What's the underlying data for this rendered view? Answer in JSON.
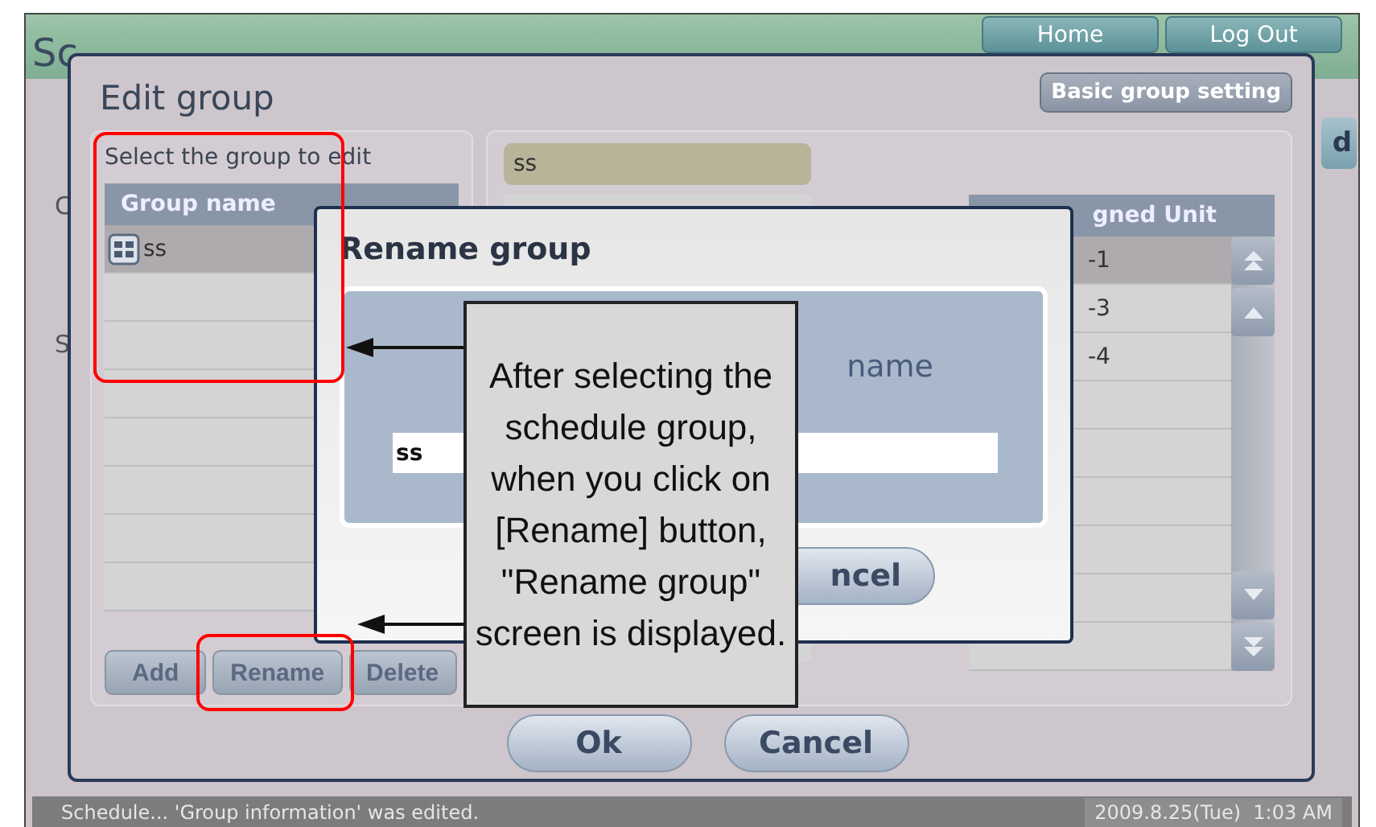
{
  "background": {
    "title": "Sc",
    "buttons": [
      "Home",
      "Log Out"
    ],
    "side_letters": [
      "C",
      "S"
    ],
    "tab_fragment": "d"
  },
  "edit_dialog": {
    "title": "Edit group",
    "basic_button": "Basic group setting",
    "prompt": "Select the group to edit",
    "group_table": {
      "column": "Group name",
      "rows": [
        {
          "name": "ss",
          "selected": true
        }
      ]
    },
    "buttons": [
      "Add",
      "Rename",
      "Delete"
    ],
    "group_name_value": "ss",
    "unit_table": {
      "column": "gned Unit",
      "rows": [
        {
          "name": "-1",
          "selected": true
        },
        {
          "name": "-3",
          "selected": false
        },
        {
          "name": "-4",
          "selected": false
        }
      ]
    },
    "footer_buttons": [
      "Ok",
      "Cancel"
    ]
  },
  "rename_dialog": {
    "title": "Rename group",
    "label": "name",
    "value": "ss",
    "buttons": [
      "ncel"
    ]
  },
  "callout": {
    "text": "After selecting the schedule group, when you click on [Rename] button, \"Rename group\" screen is displayed."
  },
  "status_bar": {
    "message": "Schedule... 'Group information' was edited.",
    "datetime": "2009.8.25(Tue)  1:03 AM"
  }
}
